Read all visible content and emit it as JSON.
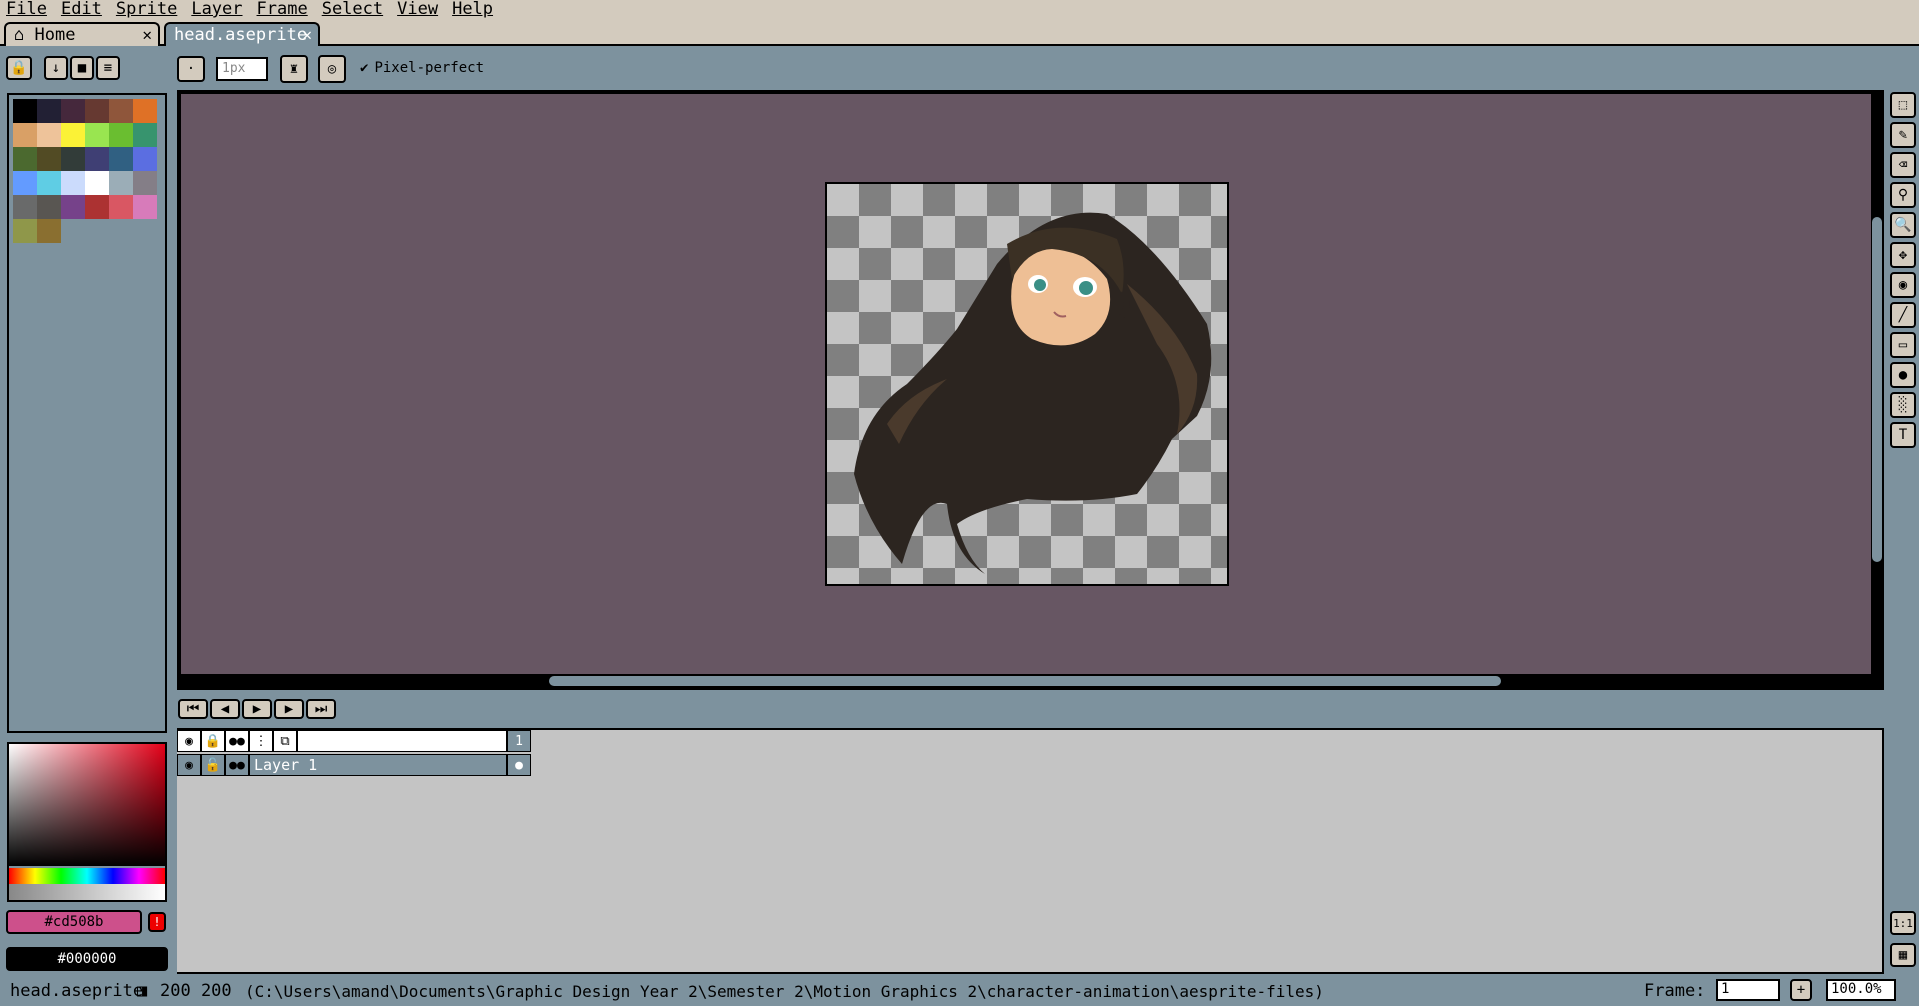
{
  "menu": [
    "File",
    "Edit",
    "Sprite",
    "Layer",
    "Frame",
    "Select",
    "View",
    "Help"
  ],
  "tabs": {
    "home": "Home",
    "active": "head.aseprite"
  },
  "contextbar": {
    "brush_size": "1px",
    "pixel_perfect": "Pixel-perfect"
  },
  "palette": {
    "colors": [
      "#000000",
      "#222034",
      "#45283c",
      "#663931",
      "#8f563b",
      "#df7126",
      "#d9a066",
      "#eec39a",
      "#fbf236",
      "#99e550",
      "#6abe30",
      "#37946e",
      "#4b692f",
      "#524b24",
      "#323c39",
      "#3f3f74",
      "#306082",
      "#5b6ee1",
      "#639bff",
      "#5fcde4",
      "#cbdbfc",
      "#ffffff",
      "#9badb7",
      "#847e87",
      "#696a6a",
      "#595652",
      "#76428a",
      "#ac3232",
      "#d95763",
      "#d77bba",
      "#8f974a",
      "#8a6f30"
    ]
  },
  "colors": {
    "fg_hex": "#cd508b",
    "bg_hex": "#000000",
    "accent": "#cd508b"
  },
  "timeline": {
    "frame_header": "1",
    "layer_name": "Layer 1"
  },
  "status": {
    "filename": "head.aseprite",
    "size": "200 200",
    "path": "(C:\\Users\\amand\\Documents\\Graphic Design Year 2\\Semester 2\\Motion Graphics 2\\character-animation\\aesprite-files)",
    "frame_label": "Frame:",
    "frame_value": "1",
    "zoom": "100.0%"
  },
  "tools": [
    "marquee-icon",
    "pencil-icon",
    "eraser-icon",
    "eyedropper-icon",
    "zoom-icon",
    "move-icon",
    "fill-icon",
    "line-icon",
    "rectangle-icon",
    "ellipse-icon",
    "blur-icon",
    "text-icon"
  ]
}
